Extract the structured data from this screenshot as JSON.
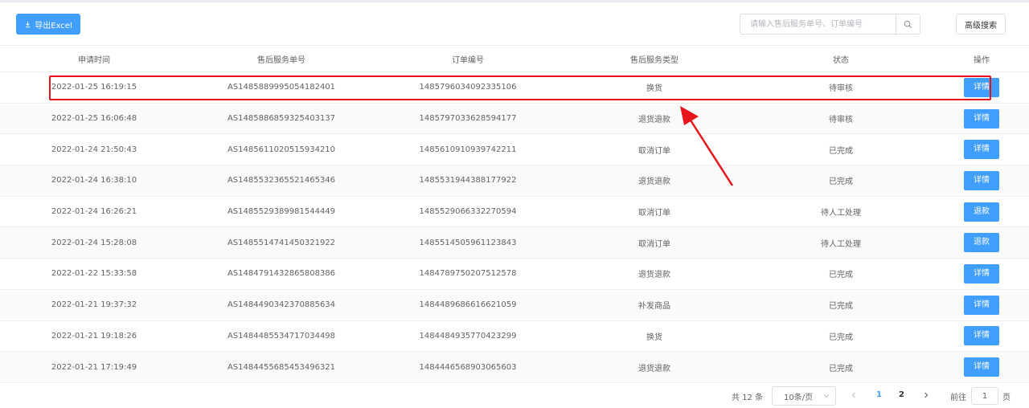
{
  "toolbar": {
    "export_label": "导出Excel",
    "export_icon": "download-icon",
    "search_placeholder": "请输入售后服务单号、订单编号",
    "search_icon": "search-icon",
    "advanced_search_label": "高级搜索"
  },
  "table": {
    "columns": [
      "申请时间",
      "售后服务单号",
      "订单编号",
      "售后服务类型",
      "状态",
      "操作"
    ],
    "rows": [
      {
        "time": "2022-01-25 16:19:15",
        "service_no": "AS1485889995054182401",
        "order_no": "1485796034092335106",
        "type": "换货",
        "status": "待审核",
        "action": "详情"
      },
      {
        "time": "2022-01-25 16:06:48",
        "service_no": "AS1485886859325403137",
        "order_no": "1485797033628594177",
        "type": "退货退款",
        "status": "待审核",
        "action": "详情"
      },
      {
        "time": "2022-01-24 21:50:43",
        "service_no": "AS1485611020515934210",
        "order_no": "1485610910939742211",
        "type": "取消订单",
        "status": "已完成",
        "action": "详情"
      },
      {
        "time": "2022-01-24 16:38:10",
        "service_no": "AS1485532365521465346",
        "order_no": "1485531944388177922",
        "type": "退货退款",
        "status": "已完成",
        "action": "详情"
      },
      {
        "time": "2022-01-24 16:26:21",
        "service_no": "AS1485529389981544449",
        "order_no": "1485529066332270594",
        "type": "取消订单",
        "status": "待人工处理",
        "action": "退款"
      },
      {
        "time": "2022-01-24 15:28:08",
        "service_no": "AS1485514741450321922",
        "order_no": "1485514505961123843",
        "type": "取消订单",
        "status": "待人工处理",
        "action": "退款"
      },
      {
        "time": "2022-01-22 15:33:58",
        "service_no": "AS1484791432865808386",
        "order_no": "1484789750207512578",
        "type": "退货退款",
        "status": "已完成",
        "action": "详情"
      },
      {
        "time": "2022-01-21 19:37:32",
        "service_no": "AS1484490342370885634",
        "order_no": "1484489686616621059",
        "type": "补发商品",
        "status": "已完成",
        "action": "详情"
      },
      {
        "time": "2022-01-21 19:18:26",
        "service_no": "AS1484485534717034498",
        "order_no": "1484484935770423299",
        "type": "换货",
        "status": "已完成",
        "action": "详情"
      },
      {
        "time": "2022-01-21 17:19:49",
        "service_no": "AS1484455685453496321",
        "order_no": "1484446568903065603",
        "type": "退货退款",
        "status": "已完成",
        "action": "详情"
      }
    ]
  },
  "pagination": {
    "total_label": "共 12 条",
    "page_size_label": "10条/页",
    "pages": [
      "1",
      "2"
    ],
    "current_page": "1",
    "goto_prefix": "前往",
    "goto_value": "1",
    "goto_suffix": "页"
  },
  "colors": {
    "primary": "#409eff",
    "annotation": "#e8141b"
  }
}
